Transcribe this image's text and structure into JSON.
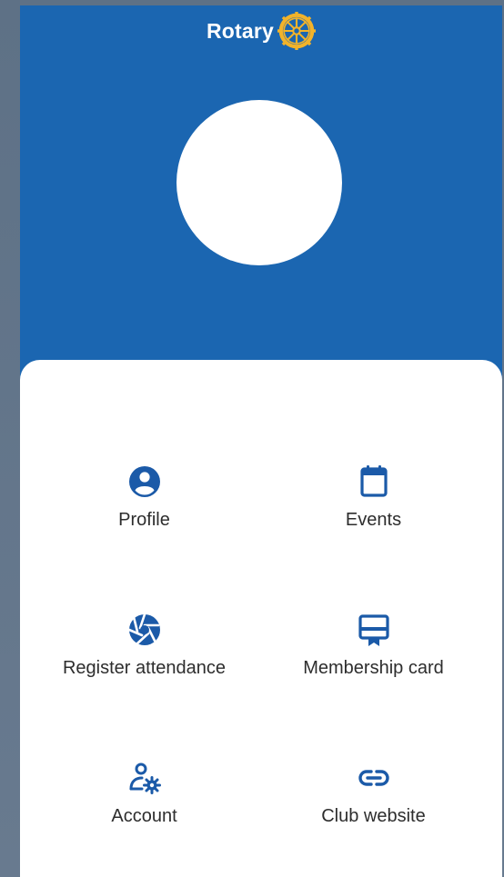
{
  "brand": {
    "name": "Rotary",
    "logo_icon": "rotary-wheel-icon",
    "primary_color": "#1b66b1",
    "logo_color": "#f2b32a"
  },
  "menu": {
    "items": [
      {
        "label": "Profile",
        "icon": "profile-icon"
      },
      {
        "label": "Events",
        "icon": "calendar-icon"
      },
      {
        "label": "Register attendance",
        "icon": "camera-shutter-icon"
      },
      {
        "label": "Membership card",
        "icon": "membership-card-icon"
      },
      {
        "label": "Account",
        "icon": "account-settings-icon"
      },
      {
        "label": "Club website",
        "icon": "link-icon"
      }
    ]
  }
}
